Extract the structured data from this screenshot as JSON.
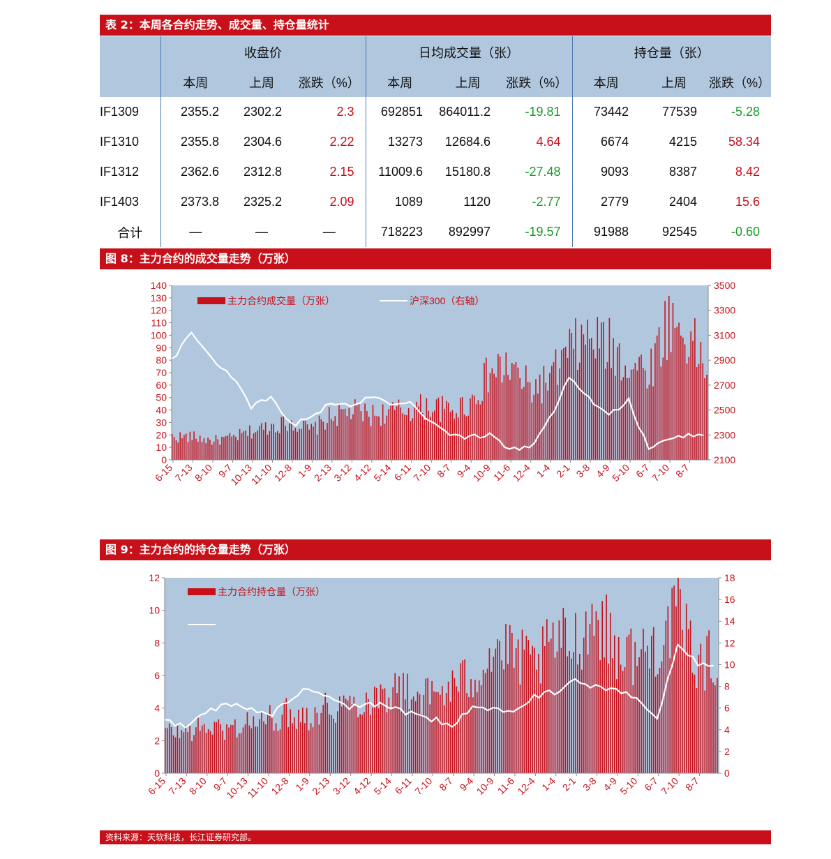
{
  "table": {
    "title": "表 2：本周各合约走势、成交量、持仓量统计",
    "groups": [
      "收盘价",
      "日均成交量（张）",
      "持仓量（张）"
    ],
    "subheaders": [
      "本周",
      "上周",
      "涨跌（%）",
      "本周",
      "上周",
      "涨跌（%）",
      "本周",
      "上周",
      "涨跌（%）"
    ],
    "rows": [
      {
        "code": "IF1309",
        "cells": [
          "2355.2",
          "2302.2",
          "2.3",
          "692851",
          "864011.2",
          "-19.81",
          "73442",
          "77539",
          "-5.28"
        ]
      },
      {
        "code": "IF1310",
        "cells": [
          "2355.8",
          "2304.6",
          "2.22",
          "13273",
          "12684.6",
          "4.64",
          "6674",
          "4215",
          "58.34"
        ]
      },
      {
        "code": "IF1312",
        "cells": [
          "2362.6",
          "2312.8",
          "2.15",
          "11009.6",
          "15180.8",
          "-27.48",
          "9093",
          "8387",
          "8.42"
        ]
      },
      {
        "code": "IF1403",
        "cells": [
          "2373.8",
          "2325.2",
          "2.09",
          "1089",
          "1120",
          "-2.77",
          "2779",
          "2404",
          "15.6"
        ]
      },
      {
        "code": "合计",
        "cells": [
          "—",
          "—",
          "—",
          "718223",
          "892997",
          "-19.57",
          "91988",
          "92545",
          "-0.60"
        ]
      }
    ],
    "colors": {
      "up": "#c8101a",
      "down": "#1a9b2a",
      "header_bg": "#b0c7de"
    }
  },
  "fig8_title": "图 8：主力合约的成交量走势（万张）",
  "fig9_title": "图 9：主力合约的持仓量走势（万张）",
  "footer": "资料来源：天软科技，长江证券研究部。",
  "chart_data": [
    {
      "type": "bar",
      "title": "",
      "categories": [
        "6-15",
        "7-13",
        "8-10",
        "9-7",
        "10-13",
        "11-10",
        "12-8",
        "1-9",
        "2-13",
        "3-12",
        "4-12",
        "5-14",
        "6-11",
        "7-10",
        "8-7",
        "9-4",
        "10-9",
        "11-6",
        "12-4",
        "1-4",
        "2-1",
        "3-8",
        "4-9",
        "5-10",
        "6-7",
        "7-10",
        "8-7"
      ],
      "series": [
        {
          "name": "主力合约成交量（万张）",
          "kind": "bar",
          "axis": "left",
          "values": [
            18,
            15,
            17,
            22,
            27,
            30,
            23,
            34,
            38,
            35,
            37,
            40,
            42,
            38,
            45,
            68,
            72,
            55,
            62,
            85,
            95,
            88,
            75,
            70,
            110,
            95,
            70
          ]
        },
        {
          "name": "沪深300（右轴）",
          "kind": "line",
          "axis": "right",
          "values": [
            2900,
            3120,
            2920,
            2780,
            2520,
            2600,
            2380,
            2440,
            2560,
            2520,
            2620,
            2560,
            2560,
            2420,
            2300,
            2280,
            2300,
            2180,
            2200,
            2420,
            2760,
            2600,
            2460,
            2580,
            2180,
            2260,
            2300
          ]
        }
      ],
      "ylim": [
        0,
        140
      ],
      "ylim_right": [
        2100,
        3500
      ],
      "yticks": [
        0,
        10,
        20,
        30,
        40,
        50,
        60,
        70,
        80,
        90,
        100,
        110,
        120,
        130,
        140
      ],
      "yticks_right": [
        2100,
        2300,
        2500,
        2700,
        2900,
        3100,
        3300,
        3500
      ],
      "legend": "top-left",
      "colors": {
        "bar": "#c8101a",
        "line": "#ffffff",
        "plot_bg": "#b0c7de",
        "axis_text": "#c8101a"
      }
    },
    {
      "type": "bar",
      "title": "",
      "categories": [
        "6-15",
        "7-13",
        "8-10",
        "9-7",
        "10-13",
        "11-10",
        "12-8",
        "1-9",
        "2-13",
        "3-12",
        "4-12",
        "5-14",
        "6-11",
        "7-10",
        "8-7",
        "9-4",
        "10-9",
        "11-6",
        "12-4",
        "1-4",
        "2-1",
        "3-8",
        "4-9",
        "5-10",
        "6-7",
        "7-10",
        "8-7"
      ],
      "series": [
        {
          "name": "主力合约持仓量（万张）",
          "kind": "bar",
          "axis": "left",
          "values": [
            2.5,
            2.8,
            2.6,
            3.0,
            3.2,
            3.6,
            3.5,
            4.0,
            4.2,
            4.5,
            5.0,
            4.8,
            4.6,
            5.2,
            5.8,
            7.5,
            7.0,
            6.5,
            7.8,
            8.0,
            9.5,
            7.5,
            7.0,
            7.8,
            9.5,
            6.5,
            7.0
          ]
        },
        {
          "name": "",
          "kind": "line",
          "axis": "right",
          "values": [
            5.0,
            4.2,
            5.5,
            6.5,
            6.0,
            5.2,
            6.5,
            8.0,
            7.0,
            6.0,
            6.5,
            6.0,
            5.5,
            5.0,
            4.5,
            6.0,
            5.8,
            5.5,
            7.0,
            7.5,
            8.5,
            8.0,
            7.5,
            7.0,
            5.0,
            12.0,
            10.0
          ]
        }
      ],
      "ylim": [
        0,
        12
      ],
      "ylim_right": [
        0,
        18
      ],
      "yticks": [
        0,
        2,
        4,
        6,
        8,
        10,
        12
      ],
      "yticks_right": [
        0,
        2,
        4,
        6,
        8,
        10,
        12,
        14,
        16,
        18
      ],
      "legend": "top-left",
      "colors": {
        "bar": "#c8101a",
        "line": "#ffffff",
        "plot_bg": "#b0c7de",
        "axis_text": "#c8101a"
      }
    }
  ]
}
